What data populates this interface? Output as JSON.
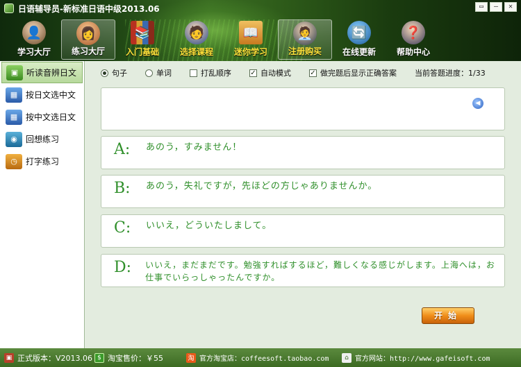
{
  "window": {
    "title": "日语辅导员-新标准日语中级2013.06",
    "controls": [
      "▭",
      "—",
      "✕"
    ]
  },
  "nav": [
    {
      "label": "学习大厅",
      "active": false
    },
    {
      "label": "练习大厅",
      "active": true
    },
    {
      "label": "入门基础",
      "active": false
    },
    {
      "label": "选择课程",
      "active": false
    },
    {
      "label": "迷你学习",
      "active": false
    },
    {
      "label": "注册购买",
      "active": false
    },
    {
      "label": "在线更新",
      "active": false
    },
    {
      "label": "帮助中心",
      "active": false
    }
  ],
  "sidebar": {
    "items": [
      {
        "label": "听读音辨日文",
        "selected": true
      },
      {
        "label": "按日文选中文",
        "selected": false
      },
      {
        "label": "按中文选日文",
        "selected": false
      },
      {
        "label": "回想练习",
        "selected": false
      },
      {
        "label": "打字练习",
        "selected": false
      }
    ]
  },
  "options": {
    "radio_sentence": "句子",
    "radio_word": "单词",
    "shuffle": "打乱顺序",
    "auto_mode": "自动模式",
    "show_answer": "做完题后显示正确答案",
    "progress_label": "当前答题进度：1/33"
  },
  "answers": [
    {
      "letter": "A:",
      "text": "あのう，すみません！"
    },
    {
      "letter": "B:",
      "text": "あのう，失礼ですが，先ほどの方じゃありませんか。"
    },
    {
      "letter": "C:",
      "text": "いいえ，どういたしまして。"
    },
    {
      "letter": "D:",
      "text": "いいえ，まだまだです。勉強すればするほど，難しくなる感じがします。上海へは，お仕事でいらっしゃったんですか。"
    }
  ],
  "start_button": "开始",
  "status": {
    "version": "正式版本：V2013.06",
    "taobao_price": "淘宝售价：￥55",
    "taobao_shop": "官方淘宝店：coffeesoft.taobao.com",
    "website": "官方网站：http://www.gafeisoft.com"
  }
}
